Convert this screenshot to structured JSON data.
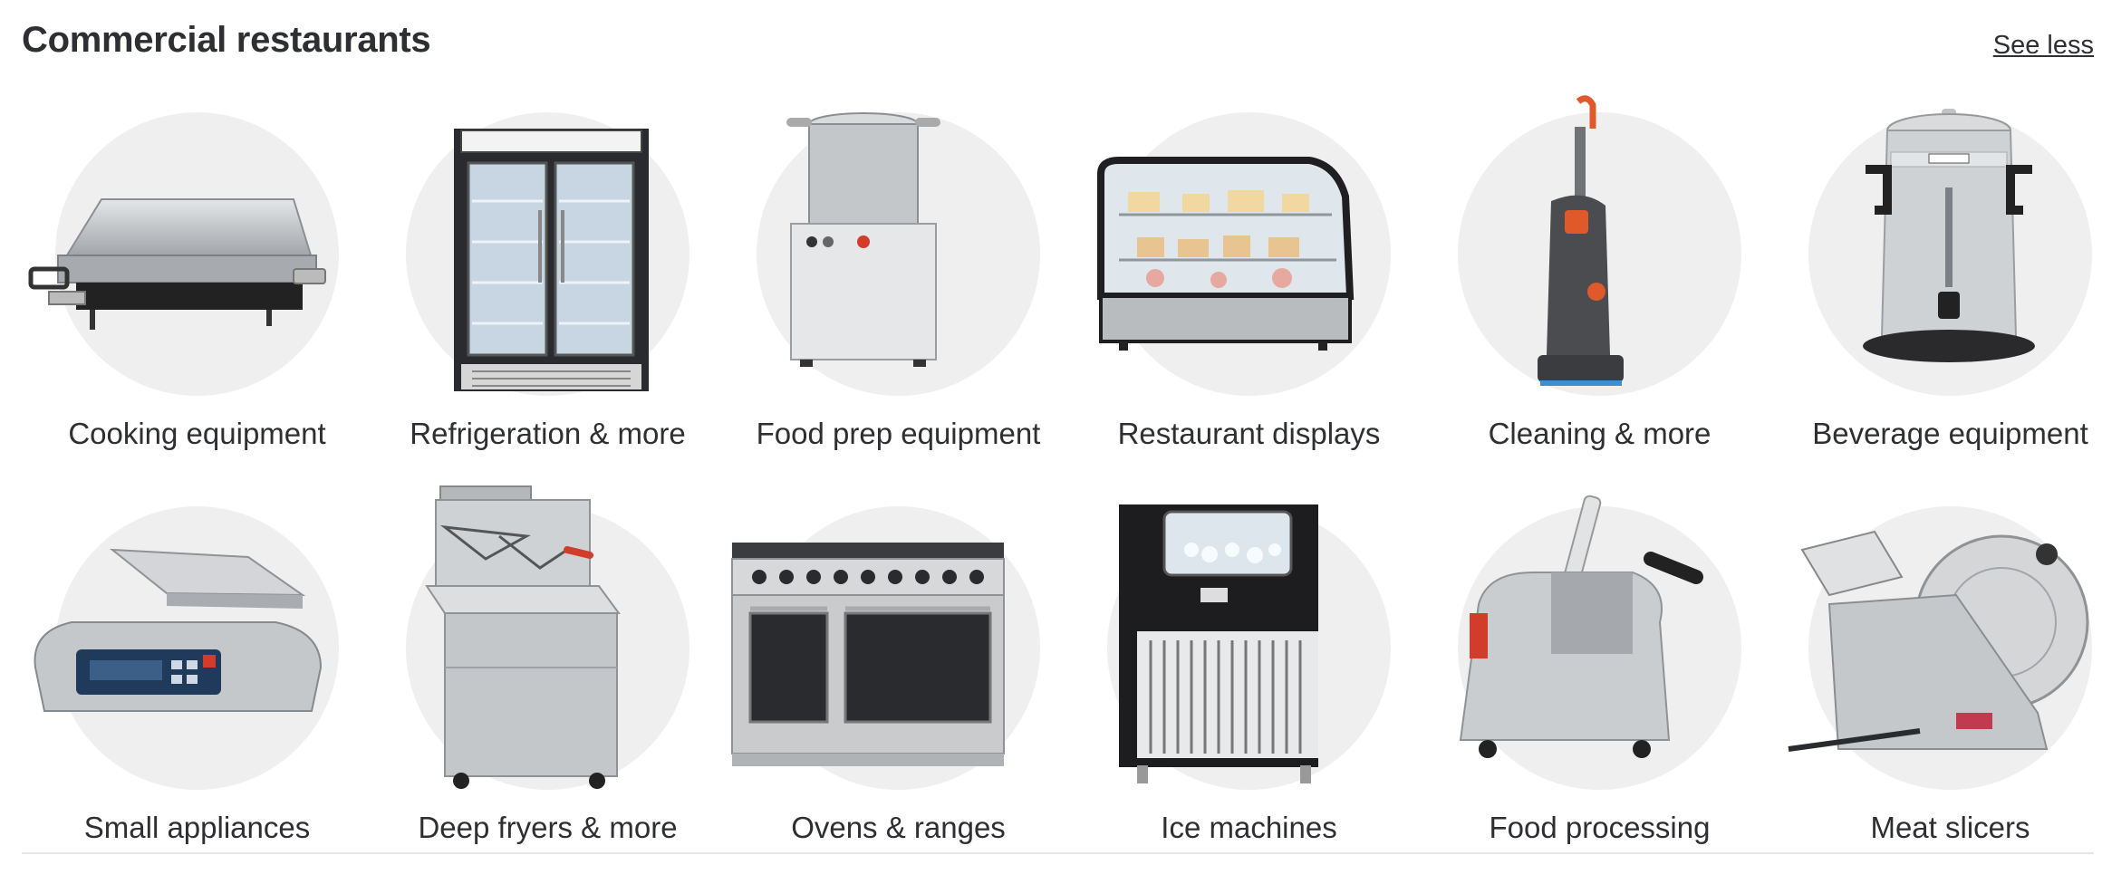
{
  "section": {
    "title": "Commercial restaurants",
    "toggle_label": "See less"
  },
  "categories": [
    {
      "label": "Cooking equipment",
      "icon": "griddle-icon"
    },
    {
      "label": "Refrigeration & more",
      "icon": "refrigerator-icon"
    },
    {
      "label": "Food prep equipment",
      "icon": "food-prep-machine-icon"
    },
    {
      "label": "Restaurant displays",
      "icon": "display-case-icon"
    },
    {
      "label": "Cleaning & more",
      "icon": "vacuum-icon"
    },
    {
      "label": "Beverage equipment",
      "icon": "coffee-urn-icon"
    },
    {
      "label": "Small appliances",
      "icon": "scale-icon"
    },
    {
      "label": "Deep fryers & more",
      "icon": "deep-fryer-icon"
    },
    {
      "label": "Ovens & ranges",
      "icon": "range-oven-icon"
    },
    {
      "label": "Ice machines",
      "icon": "ice-machine-icon"
    },
    {
      "label": "Food processing",
      "icon": "food-processor-icon"
    },
    {
      "label": "Meat slicers",
      "icon": "meat-slicer-icon"
    }
  ],
  "colors": {
    "circle_bg": "#efefef",
    "text": "#2e2f32",
    "stainless": "#c9cbcd",
    "dark": "#1e1e20",
    "accent_red": "#d23c2a",
    "accent_orange": "#e0592a"
  }
}
